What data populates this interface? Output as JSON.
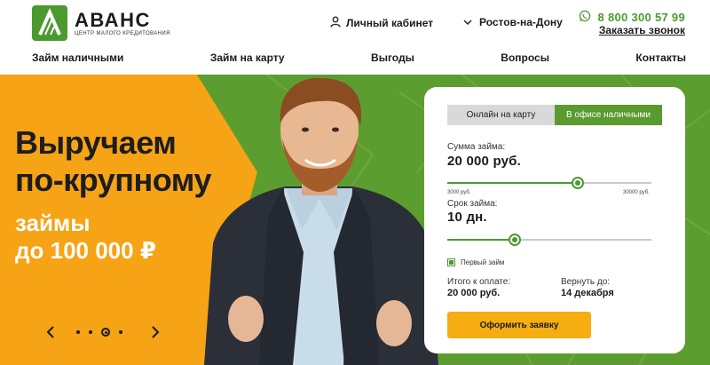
{
  "header": {
    "logo_name": "АВАНС",
    "logo_sub": "ЦЕНТР МАЛОГО КРЕДИТОВАНИЯ",
    "cabinet_label": "Личный кабинет",
    "city_label": "Ростов-на-Дону",
    "phone": "8 800 300 57 99",
    "callback_label": "Заказать звонок"
  },
  "nav": {
    "items": [
      "Займ наличными",
      "Займ на карту",
      "Выгоды",
      "Вопросы",
      "Контакты"
    ]
  },
  "hero": {
    "headline_1": "Выручаем",
    "headline_2": "по-крупному",
    "subline_1": "займы",
    "subline_2": "до 100 000 ₽",
    "slides_count": 4,
    "active_slide": 3
  },
  "calculator": {
    "tabs": [
      "Онлайн на карту",
      "В офисе наличными"
    ],
    "active_tab": 1,
    "amount_label": "Сумма займа:",
    "amount_value": "20 000 руб.",
    "amount_min": "3000 руб.",
    "amount_max": "30000 руб.",
    "amount_fraction": 0.64,
    "term_label": "Срок займа:",
    "term_value": "10 дн.",
    "term_fraction": 0.33,
    "first_loan_label": "Первый займ",
    "first_loan_checked": true,
    "total_label": "Итого к оплате:",
    "total_value": "20 000 руб.",
    "return_label": "Вернуть до:",
    "return_value": "14 декабря",
    "submit_label": "Оформить заявку"
  },
  "colors": {
    "brand_green": "#4b9a2f",
    "accent_orange": "#f5ad12",
    "hero_orange": "#f6a316"
  },
  "icons": [
    "logo-icon",
    "user-icon",
    "chevron-down-icon",
    "whatsapp-icon",
    "chevron-left-icon",
    "chevron-right-icon",
    "checkbox-icon"
  ]
}
